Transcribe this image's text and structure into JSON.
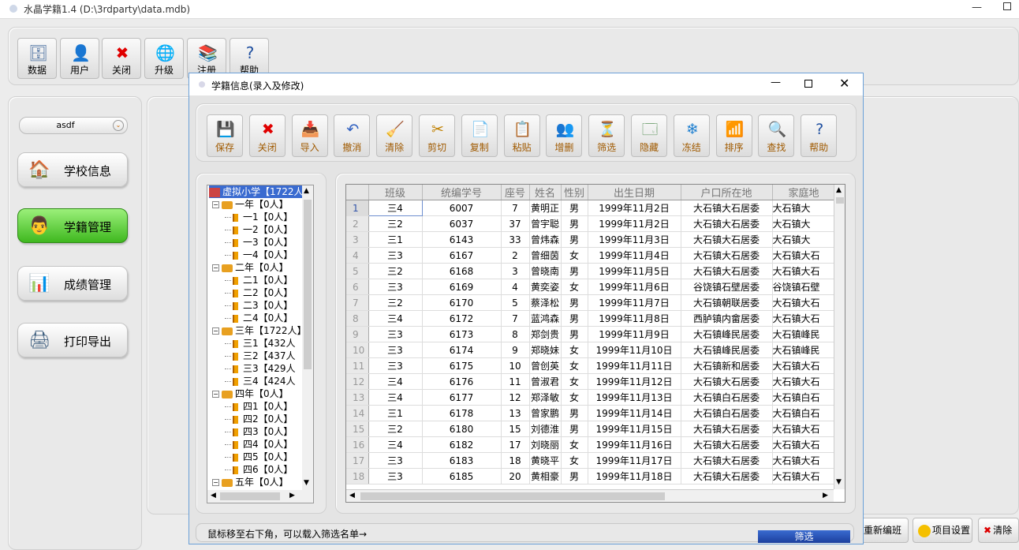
{
  "main": {
    "title": "水晶学籍1.4  (D:\\3rdparty\\data.mdb)",
    "toolbar": [
      {
        "label": "数据",
        "icon": "database-icon",
        "glyph": "🗄"
      },
      {
        "label": "用户",
        "icon": "user-icon",
        "glyph": "👤"
      },
      {
        "label": "关闭",
        "icon": "close-icon",
        "glyph": "✖"
      },
      {
        "label": "升级",
        "icon": "upgrade-icon",
        "glyph": "🌐"
      },
      {
        "label": "注册",
        "icon": "register-icon",
        "glyph": "📚"
      },
      {
        "label": "帮助",
        "icon": "help-icon",
        "glyph": "?"
      }
    ],
    "user_select": "asdf",
    "sidebar": [
      {
        "label": "学校信息",
        "icon": "school-icon",
        "glyph": "🏠"
      },
      {
        "label": "学籍管理",
        "icon": "student-record-icon",
        "glyph": "👨",
        "active": true
      },
      {
        "label": "成绩管理",
        "icon": "score-chart-icon",
        "glyph": "📊"
      },
      {
        "label": "打印导出",
        "icon": "printer-icon",
        "glyph": "🖨"
      }
    ],
    "bottom_buttons": [
      {
        "label": "重新编班",
        "icon": "regroup-icon"
      },
      {
        "label": "项目设置",
        "icon": "settings-icon"
      },
      {
        "label": "清除",
        "icon": "clear-icon"
      }
    ]
  },
  "dialog": {
    "title": "学籍信息(录入及修改)",
    "toolbar": [
      {
        "label": "保存",
        "icon": "save-icon",
        "glyph": "💾"
      },
      {
        "label": "关闭",
        "icon": "close-icon",
        "glyph": "✖"
      },
      {
        "label": "导入",
        "icon": "import-icon",
        "glyph": "📥"
      },
      {
        "label": "撤消",
        "icon": "undo-icon",
        "glyph": "↶"
      },
      {
        "label": "清除",
        "icon": "clear-icon",
        "glyph": "🧹"
      },
      {
        "label": "剪切",
        "icon": "cut-icon",
        "glyph": "✂"
      },
      {
        "label": "复制",
        "icon": "copy-icon",
        "glyph": "📄"
      },
      {
        "label": "粘贴",
        "icon": "paste-icon",
        "glyph": "📋"
      },
      {
        "label": "增删",
        "icon": "add-remove-icon",
        "glyph": "👥"
      },
      {
        "label": "筛选",
        "icon": "filter-icon",
        "glyph": "⏳"
      },
      {
        "label": "隐藏",
        "icon": "hide-icon",
        "glyph": "🗔"
      },
      {
        "label": "冻结",
        "icon": "freeze-icon",
        "glyph": "❄"
      },
      {
        "label": "排序",
        "icon": "sort-icon",
        "glyph": "📶"
      },
      {
        "label": "查找",
        "icon": "search-icon",
        "glyph": "🔍"
      },
      {
        "label": "帮助",
        "icon": "help-icon",
        "glyph": "?"
      }
    ],
    "tree": [
      {
        "level": 0,
        "label": "虚拟小学【1722人",
        "type": "root"
      },
      {
        "level": 1,
        "label": "一年【0人】",
        "type": "folder"
      },
      {
        "level": 2,
        "label": "一1【0人】",
        "type": "flag"
      },
      {
        "level": 2,
        "label": "一2【0人】",
        "type": "flag"
      },
      {
        "level": 2,
        "label": "一3【0人】",
        "type": "flag"
      },
      {
        "level": 2,
        "label": "一4【0人】",
        "type": "flag"
      },
      {
        "level": 1,
        "label": "二年【0人】",
        "type": "folder"
      },
      {
        "level": 2,
        "label": "二1【0人】",
        "type": "flag"
      },
      {
        "level": 2,
        "label": "二2【0人】",
        "type": "flag"
      },
      {
        "level": 2,
        "label": "二3【0人】",
        "type": "flag"
      },
      {
        "level": 2,
        "label": "二4【0人】",
        "type": "flag"
      },
      {
        "level": 1,
        "label": "三年【1722人】",
        "type": "folder"
      },
      {
        "level": 2,
        "label": "三1【432人",
        "type": "flag"
      },
      {
        "level": 2,
        "label": "三2【437人",
        "type": "flag"
      },
      {
        "level": 2,
        "label": "三3【429人",
        "type": "flag"
      },
      {
        "level": 2,
        "label": "三4【424人",
        "type": "flag"
      },
      {
        "level": 1,
        "label": "四年【0人】",
        "type": "folder"
      },
      {
        "level": 2,
        "label": "四1【0人】",
        "type": "flag"
      },
      {
        "level": 2,
        "label": "四2【0人】",
        "type": "flag"
      },
      {
        "level": 2,
        "label": "四3【0人】",
        "type": "flag"
      },
      {
        "level": 2,
        "label": "四4【0人】",
        "type": "flag"
      },
      {
        "level": 2,
        "label": "四5【0人】",
        "type": "flag"
      },
      {
        "level": 2,
        "label": "四6【0人】",
        "type": "flag"
      },
      {
        "level": 1,
        "label": "五年【0人】",
        "type": "folder"
      }
    ],
    "grid": {
      "columns": [
        "班级",
        "统编学号",
        "座号",
        "姓名",
        "性别",
        "出生日期",
        "户口所在地",
        "家庭地"
      ],
      "rows": [
        [
          "1",
          "三4",
          "6007",
          "7",
          "黄明正",
          "男",
          "1999年11月2日",
          "大石镇大石居委",
          "大石镇大"
        ],
        [
          "2",
          "三2",
          "6037",
          "37",
          "曾宇聪",
          "男",
          "1999年11月2日",
          "大石镇大石居委",
          "大石镇大"
        ],
        [
          "3",
          "三1",
          "6143",
          "33",
          "曾炜森",
          "男",
          "1999年11月3日",
          "大石镇大石居委",
          "大石镇大"
        ],
        [
          "4",
          "三3",
          "6167",
          "2",
          "曾细茵",
          "女",
          "1999年11月4日",
          "大石镇大石居委",
          "大石镇大石"
        ],
        [
          "5",
          "三2",
          "6168",
          "3",
          "曾晓南",
          "男",
          "1999年11月5日",
          "大石镇大石居委",
          "大石镇大石"
        ],
        [
          "6",
          "三3",
          "6169",
          "4",
          "黄奕姿",
          "女",
          "1999年11月6日",
          "谷饶镇石壁居委",
          "谷饶镇石壁"
        ],
        [
          "7",
          "三2",
          "6170",
          "5",
          "蔡泽松",
          "男",
          "1999年11月7日",
          "大石镇朝联居委",
          "大石镇大石"
        ],
        [
          "8",
          "三4",
          "6172",
          "7",
          "蓝鸿森",
          "男",
          "1999年11月8日",
          "西胪镇内畲居委",
          "大石镇大石"
        ],
        [
          "9",
          "三3",
          "6173",
          "8",
          "郑剑贵",
          "男",
          "1999年11月9日",
          "大石镇峰民居委",
          "大石镇峰民"
        ],
        [
          "10",
          "三3",
          "6174",
          "9",
          "郑晓妹",
          "女",
          "1999年11月10日",
          "大石镇峰民居委",
          "大石镇峰民"
        ],
        [
          "11",
          "三3",
          "6175",
          "10",
          "曾创英",
          "女",
          "1999年11月11日",
          "大石镇新和居委",
          "大石镇大石"
        ],
        [
          "12",
          "三4",
          "6176",
          "11",
          "曾淑君",
          "女",
          "1999年11月12日",
          "大石镇大石居委",
          "大石镇大石"
        ],
        [
          "13",
          "三4",
          "6177",
          "12",
          "郑泽敏",
          "女",
          "1999年11月13日",
          "大石镇白石居委",
          "大石镇白石"
        ],
        [
          "14",
          "三1",
          "6178",
          "13",
          "曾家鹏",
          "男",
          "1999年11月14日",
          "大石镇白石居委",
          "大石镇白石"
        ],
        [
          "15",
          "三2",
          "6180",
          "15",
          "刘德淮",
          "男",
          "1999年11月15日",
          "大石镇大石居委",
          "大石镇大石"
        ],
        [
          "16",
          "三4",
          "6182",
          "17",
          "刘晓丽",
          "女",
          "1999年11月16日",
          "大石镇大石居委",
          "大石镇大石"
        ],
        [
          "17",
          "三3",
          "6183",
          "18",
          "黄晓平",
          "女",
          "1999年11月17日",
          "大石镇大石居委",
          "大石镇大石"
        ],
        [
          "18",
          "三3",
          "6185",
          "20",
          "黄相豪",
          "男",
          "1999年11月18日",
          "大石镇大石居委",
          "大石镇大石"
        ]
      ]
    },
    "status_text": "鼠标移至右下角，可以载入筛选名单→",
    "filter_label": "筛选"
  },
  "colors": {
    "accent": "#3fb81f",
    "selection_border": "#6d8ecf",
    "filter_bar": "#2a55b8"
  }
}
